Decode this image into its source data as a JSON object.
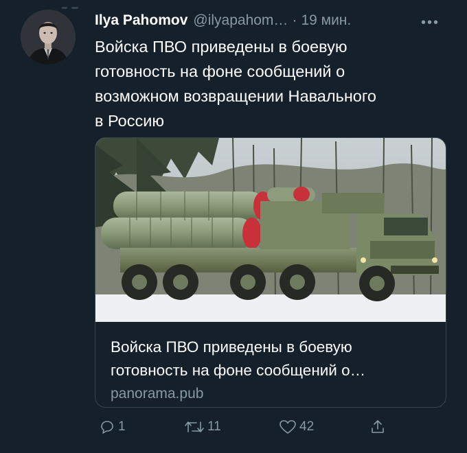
{
  "tweet": {
    "author_name": "Ilya Pahomov",
    "handle": "@ilyapahom…",
    "separator": "·",
    "time": "19 мин.",
    "more": "•••",
    "text_lines": [
      "Войска ПВО приведены в боевую",
      "готовность на фоне сообщений о",
      "возможном возвращении Навального",
      "в Россию"
    ]
  },
  "card": {
    "title_lines": [
      "Войска ПВО приведены в боевую",
      "готовность на фоне сообщений о…"
    ],
    "domain": "panorama.pub"
  },
  "actions": {
    "reply_count": "1",
    "retweet_count": "11",
    "like_count": "42"
  },
  "icons": {
    "reply": "reply-icon",
    "retweet": "retweet-icon",
    "like": "heart-icon",
    "share": "share-icon",
    "more": "more-icon"
  },
  "colors": {
    "background": "#15202b",
    "text": "#ffffff",
    "secondary_text": "#8899a6",
    "border": "#38444d"
  }
}
